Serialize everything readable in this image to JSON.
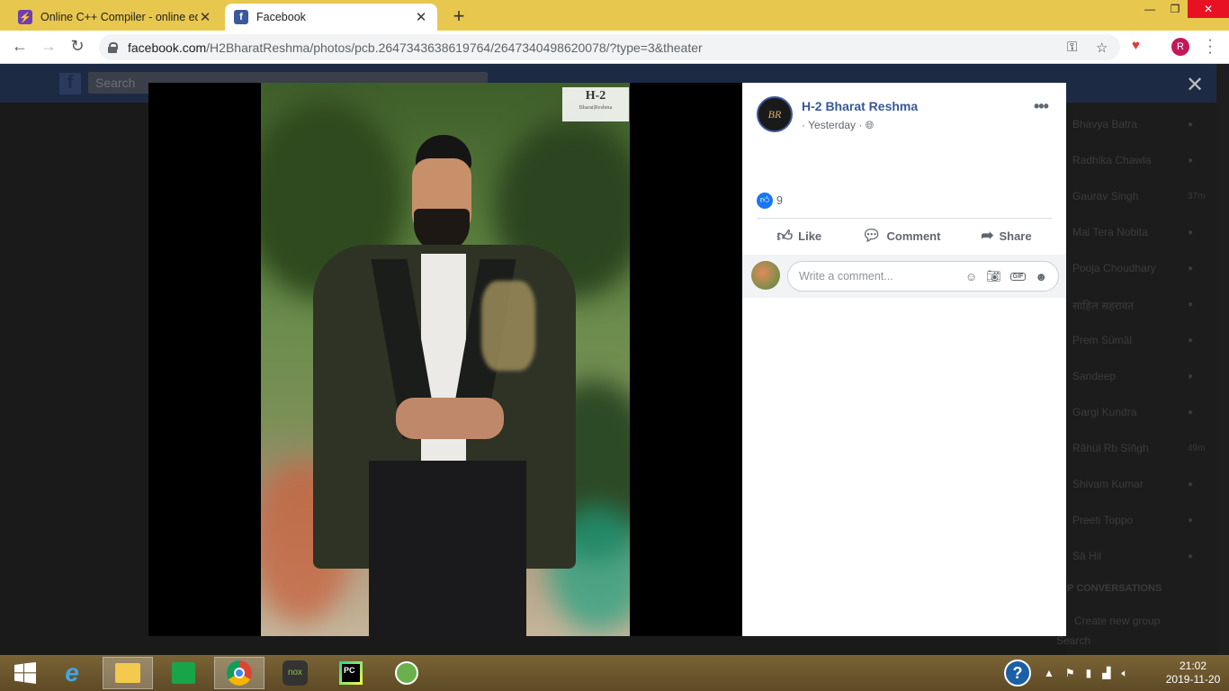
{
  "browser": {
    "tabs": [
      {
        "title": "Online C++ Compiler - online ed",
        "icon": "lightning-icon",
        "color": "#6e3fb3"
      },
      {
        "title": "Facebook",
        "icon": "facebook-icon",
        "color": "#3b5998"
      }
    ],
    "url_host": "facebook.com",
    "url_path": "/H2BharatReshma/photos/pcb.2647343638619764/2647340498620078/?type=3&theater",
    "profile_initial": "R"
  },
  "fb_header": {
    "search_placeholder": "Search",
    "logo": "f"
  },
  "chat_sidebar": {
    "contacts": [
      {
        "name": "Bhavya Batra",
        "time": "●"
      },
      {
        "name": "Radhika Chawla",
        "time": "●"
      },
      {
        "name": "Gaurav Singh",
        "time": "37m"
      },
      {
        "name": "Mai Tera Nobita",
        "time": "●"
      },
      {
        "name": "Pooja Choudhary",
        "time": "●"
      },
      {
        "name": "साहिल सहरावत",
        "time": "●"
      },
      {
        "name": "Prem Sümâl",
        "time": "●"
      },
      {
        "name": "Sandeep",
        "time": "●"
      },
      {
        "name": "Gargi Kundra",
        "time": "●"
      },
      {
        "name": "Rãhül Rb Sîñgh",
        "time": "49m"
      },
      {
        "name": "Shivam Kumar",
        "time": "●"
      },
      {
        "name": "Preeti Toppo",
        "time": "●"
      },
      {
        "name": "Sâ Hil",
        "time": "●"
      }
    ],
    "group_header": "P CONVERSATIONS",
    "create_group": "Create new group",
    "search": "Search"
  },
  "photo": {
    "watermark_title": "H-2",
    "watermark_sub": "Bharat|Reshma"
  },
  "post": {
    "page_name": "H-2 Bharat Reshma",
    "avatar_text": "BR",
    "timestamp": "· Yesterday ·",
    "reaction_count": "9",
    "like_label": "Like",
    "comment_label": "Comment",
    "share_label": "Share",
    "comment_placeholder": "Write a comment...",
    "gif_label": "GIF"
  },
  "taskbar": {
    "apps": [
      "windows-start",
      "internet-explorer",
      "file-explorer",
      "store",
      "chrome",
      "nox",
      "pycharm",
      "android-studio"
    ],
    "time": "21:02",
    "date": "2019-11-20"
  }
}
